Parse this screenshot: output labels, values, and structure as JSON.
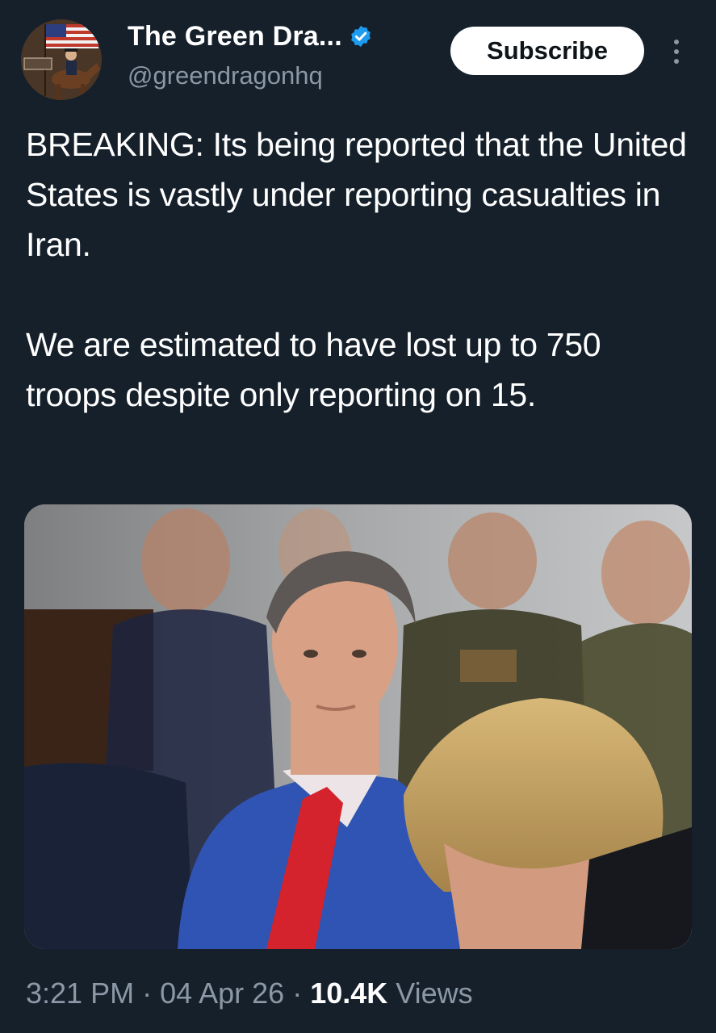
{
  "author": {
    "display_name": "The Green Dra...",
    "handle": "@greendragonhq",
    "verified": true,
    "avatar_icon": "avatar-rider-with-flag"
  },
  "actions": {
    "subscribe_label": "Subscribe",
    "more_icon": "more-vertical-icon"
  },
  "tweet": {
    "paragraphs": [
      "BREAKING: Its being reported that the United States is vastly under reporting casualties in Iran.",
      "We are estimated to have lost up to 750 troops despite only reporting on 15."
    ]
  },
  "media": {
    "type": "photo",
    "description_icon": "photo-meeting"
  },
  "meta": {
    "time": "3:21 PM",
    "separator": "·",
    "date": "04 Apr 26",
    "views_count": "10.4K",
    "views_label": "Views"
  },
  "colors": {
    "background": "#15202b",
    "text_primary": "#ffffff",
    "text_secondary": "#8b98a5",
    "verified_badge": "#1d9bf0",
    "subscribe_bg": "#ffffff"
  }
}
